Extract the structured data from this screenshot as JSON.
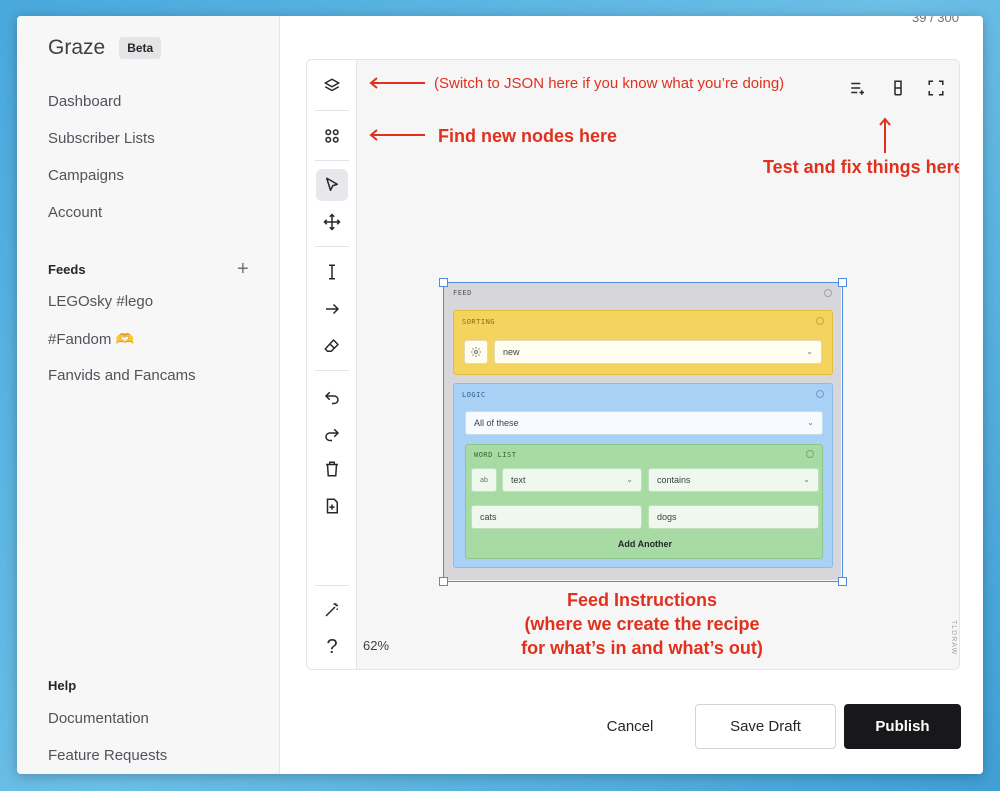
{
  "sidebar": {
    "brand": "Graze",
    "badge": "Beta",
    "nav": [
      "Dashboard",
      "Subscriber Lists",
      "Campaigns",
      "Account"
    ],
    "feeds_title": "Feeds",
    "feeds": [
      "LEGOsky #lego",
      "#Fandom 🫶",
      "Fanvids and Fancams"
    ],
    "help_title": "Help",
    "help": [
      "Documentation",
      "Feature Requests"
    ]
  },
  "main": {
    "counter": "39 / 300",
    "zoom": "62%",
    "watermark": "TLDRAW"
  },
  "annotations": {
    "json_hint": "(Switch to JSON here if you know what you’re doing)",
    "nodes_hint": "Find new nodes here",
    "test_hint": "Test and fix things here",
    "feed_line1": "Feed Instructions",
    "feed_line2": "(where we create the recipe",
    "feed_line3": "for what’s in and what’s out)"
  },
  "feed_node": {
    "label": "FEED",
    "sorting": {
      "label": "SORTING",
      "value": "new"
    },
    "logic": {
      "label": "LOGIC",
      "value": "All of these",
      "wordlist": {
        "label": "WORD LIST",
        "type_icon": "ab",
        "field": "text",
        "operator": "contains",
        "words": [
          "cats",
          "dogs"
        ],
        "add_label": "Add Another"
      }
    }
  },
  "buttons": {
    "cancel": "Cancel",
    "save_draft": "Save Draft",
    "publish": "Publish"
  },
  "colors": {
    "annotation": "#e0311d",
    "publish_bg": "#18181b",
    "sorting": "#f5d35f",
    "logic": "#a9d0f5",
    "wordlist": "#a8dba4",
    "selection": "#4e8de0"
  }
}
